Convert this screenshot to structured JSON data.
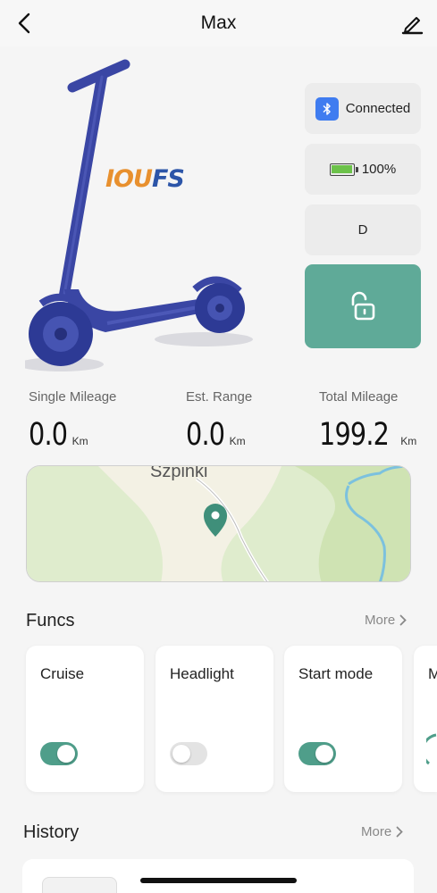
{
  "header": {
    "title": "Max"
  },
  "brand": {
    "part1": "IOU",
    "part2": "FS"
  },
  "status": {
    "connection_label": "Connected",
    "battery_text": "100%",
    "battery_level": 1.0,
    "gear": "D",
    "locked": false
  },
  "stats": [
    {
      "label": "Single Mileage",
      "value": "0.0",
      "unit": "Km"
    },
    {
      "label": "Est. Range",
      "value": "0.0",
      "unit": "Km"
    },
    {
      "label": "Total Mileage",
      "value": "199.2",
      "unit": "Km"
    }
  ],
  "map": {
    "place_label": "Szpinki"
  },
  "funcs": {
    "title": "Funcs",
    "more_label": "More",
    "items": [
      {
        "label": "Cruise",
        "on": true
      },
      {
        "label": "Headlight",
        "on": false
      },
      {
        "label": "Start mode",
        "on": true
      },
      {
        "label": "M"
      }
    ]
  },
  "history": {
    "title": "History",
    "more_label": "More"
  },
  "colors": {
    "accent": "#5faa98",
    "toggle_on": "#4f9e8a",
    "bluetooth": "#3f7cf0",
    "battery": "#6cc24a",
    "brand_orange": "#e8902e",
    "brand_blue": "#2c55a8",
    "scooter": "#3a46a4"
  }
}
